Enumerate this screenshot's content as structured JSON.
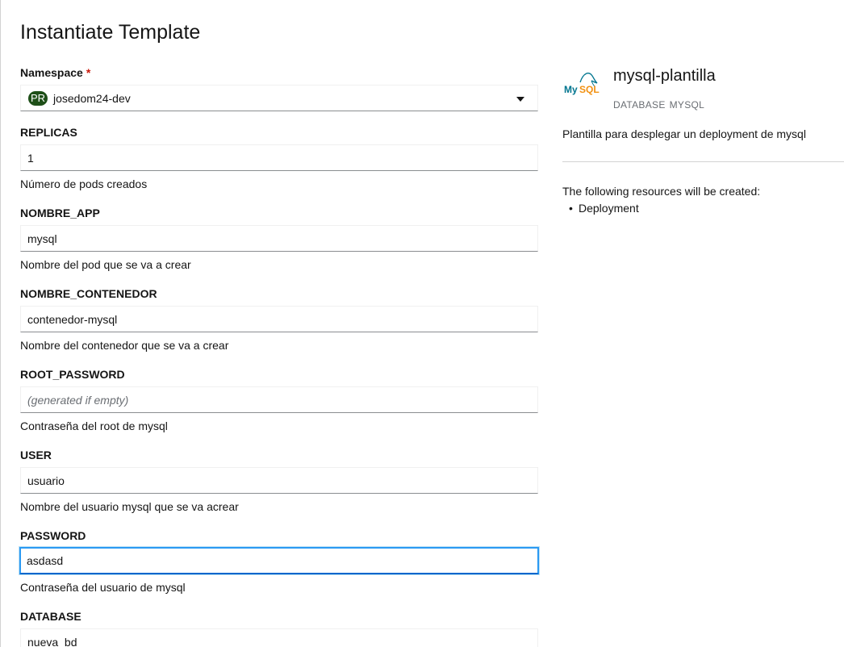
{
  "page": {
    "title": "Instantiate Template"
  },
  "namespace": {
    "label": "Namespace",
    "required_mark": "*",
    "badge": "PR",
    "value": "josedom24-dev"
  },
  "fields": [
    {
      "label": "REPLICAS",
      "value": "1",
      "placeholder": "",
      "helper": "Número de pods creados"
    },
    {
      "label": "NOMBRE_APP",
      "value": "mysql",
      "placeholder": "",
      "helper": "Nombre del pod que se va a crear"
    },
    {
      "label": "NOMBRE_CONTENEDOR",
      "value": "contenedor-mysql",
      "placeholder": "",
      "helper": "Nombre del contenedor que se va a crear"
    },
    {
      "label": "ROOT_PASSWORD",
      "value": "",
      "placeholder": "(generated if empty)",
      "helper": "Contraseña del root de mysql"
    },
    {
      "label": "USER",
      "value": "usuario",
      "placeholder": "",
      "helper": "Nombre del usuario mysql que se va acrear"
    },
    {
      "label": "PASSWORD",
      "value": "asdasd",
      "placeholder": "",
      "helper": "Contraseña del usuario de mysql"
    },
    {
      "label": "DATABASE",
      "value": "nueva_bd",
      "placeholder": "",
      "helper": ""
    }
  ],
  "template": {
    "logo_icon": "mysql-logo-icon",
    "logo_text": "MySQL",
    "name": "mysql-plantilla",
    "tags": [
      "DATABASE",
      "MYSQL"
    ],
    "description": "Plantilla para desplegar un deployment de mysql",
    "resources_title": "The following resources will be created:",
    "resources": [
      "Deployment"
    ]
  },
  "colors": {
    "accent": "#0066cc",
    "focus": "#2b9af3",
    "badge": "#1e4f18",
    "required": "#c9190b",
    "mysql_blue": "#00758f",
    "mysql_orange": "#f29111"
  }
}
